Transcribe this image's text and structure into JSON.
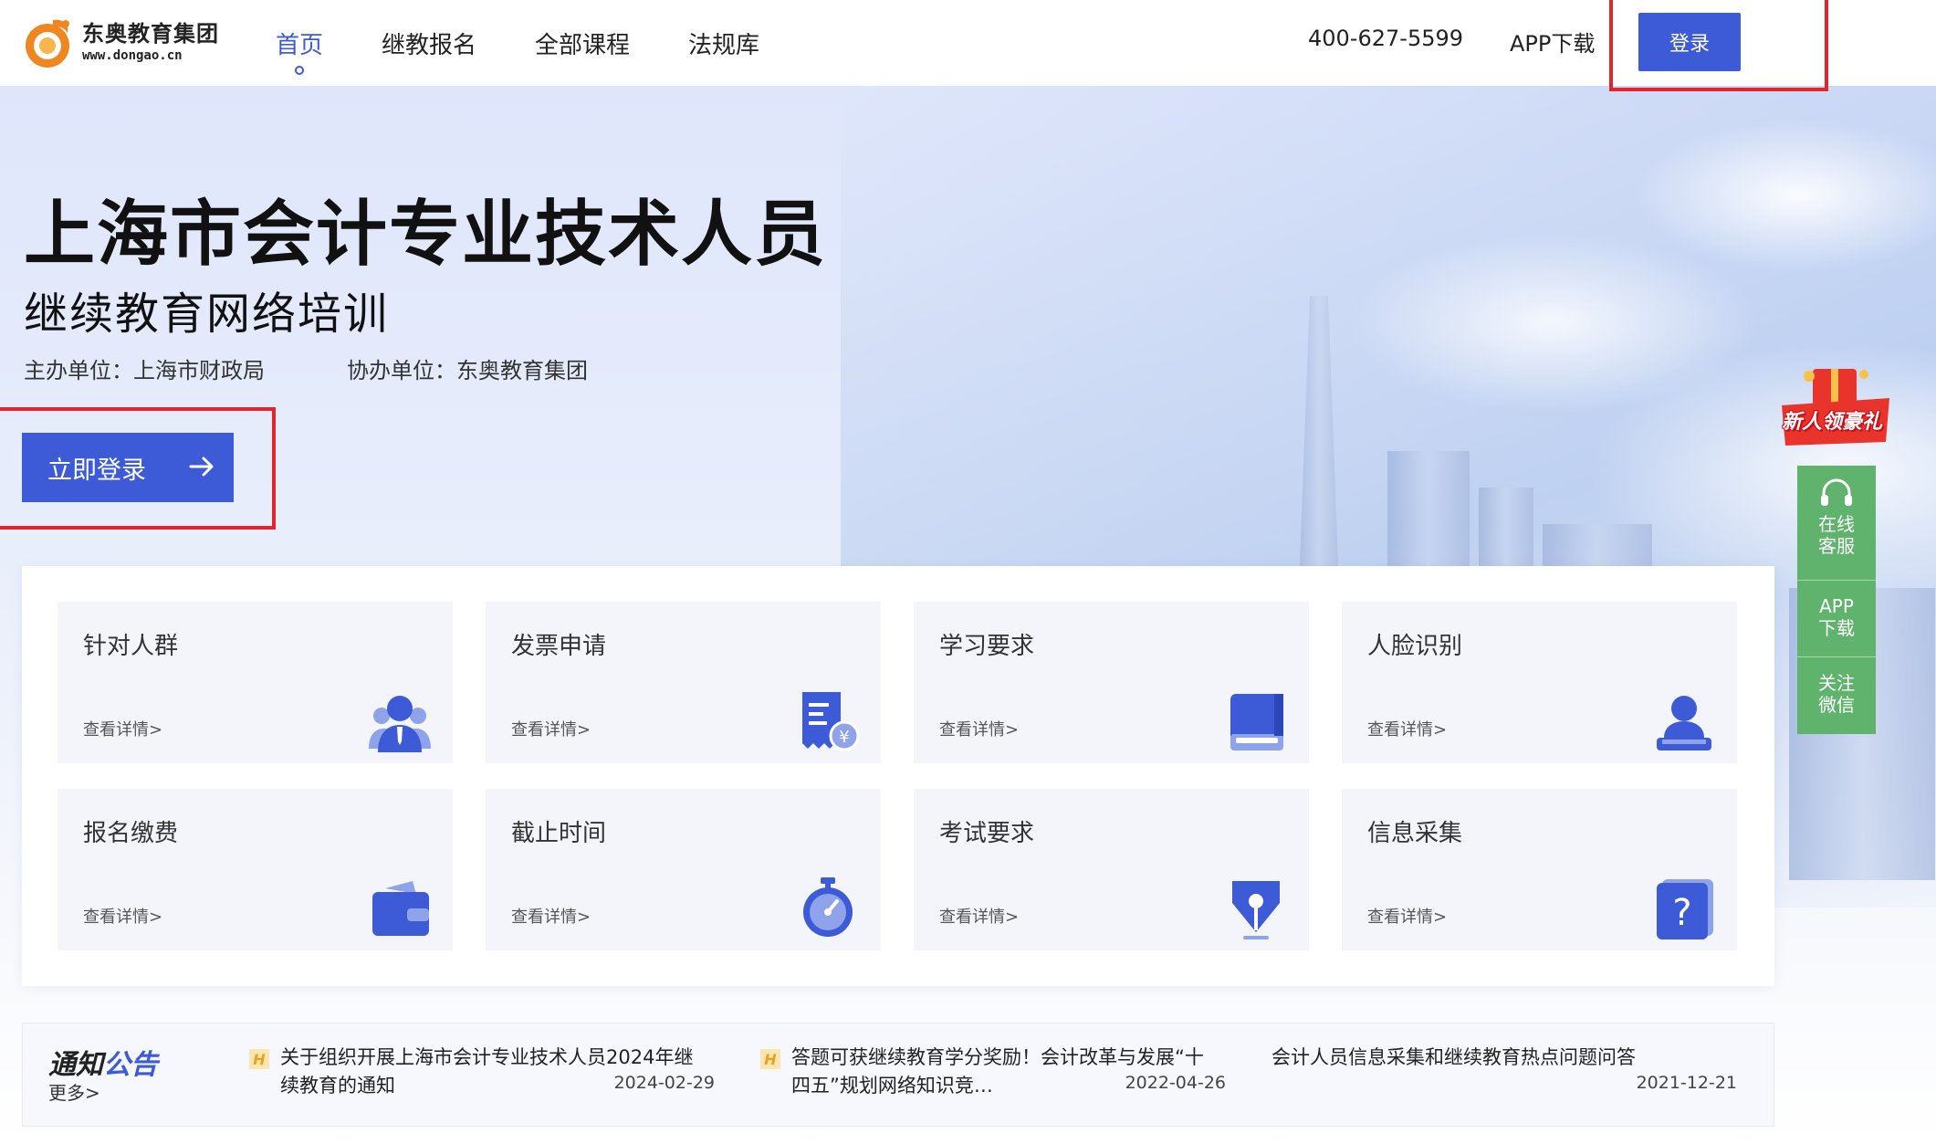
{
  "header": {
    "logo_name": "东奥教育集团",
    "logo_url": "www.dongao.cn",
    "nav": [
      {
        "label": "首页",
        "active": true
      },
      {
        "label": "继教报名"
      },
      {
        "label": "全部课程"
      },
      {
        "label": "法规库"
      }
    ],
    "hotline": "400-627-5599",
    "app_download": "APP下载",
    "login": "登录"
  },
  "hero": {
    "title": "上海市会计专业技术人员",
    "subtitle": "继续教育网络培训",
    "host": "主办单位：上海市财政局",
    "co_host": "协办单位：东奥教育集团",
    "cta": "立即登录"
  },
  "features": [
    {
      "title": "针对人群",
      "link": "查看详情>",
      "icon": "user-group-icon"
    },
    {
      "title": "发票申请",
      "link": "查看详情>",
      "icon": "invoice-icon"
    },
    {
      "title": "学习要求",
      "link": "查看详情>",
      "icon": "book-icon"
    },
    {
      "title": "人脸识别",
      "link": "查看详情>",
      "icon": "face-id-icon"
    },
    {
      "title": "报名缴费",
      "link": "查看详情>",
      "icon": "wallet-icon"
    },
    {
      "title": "截止时间",
      "link": "查看详情>",
      "icon": "stopwatch-icon"
    },
    {
      "title": "考试要求",
      "link": "查看详情>",
      "icon": "pen-nib-icon"
    },
    {
      "title": "信息采集",
      "link": "查看详情>",
      "icon": "question-icon"
    }
  ],
  "notice": {
    "heading_a": "通知",
    "heading_b": "公告",
    "more": "更多>",
    "items": [
      {
        "tag": "H",
        "text": "关于组织开展上海市会计专业技术人员2024年继续教育的通知",
        "date": "2024-02-29"
      },
      {
        "tag": "H",
        "text": "答题可获继续教育学分奖励！会计改革与发展“十四五”规划网络知识竞…",
        "date": "2022-04-26"
      },
      {
        "text": "会计人员信息采集和继续教育热点问题问答",
        "date": "2021-12-21"
      }
    ]
  },
  "float": {
    "gift": "新人领豪礼",
    "items": [
      {
        "label": "在线客服",
        "icon": "headset-icon"
      },
      {
        "label": "APP下载"
      },
      {
        "label": "关注微信"
      }
    ]
  },
  "colors": {
    "primary": "#3d5bd6",
    "highlight": "#e0262b",
    "float_bg": "#5fb36c"
  }
}
